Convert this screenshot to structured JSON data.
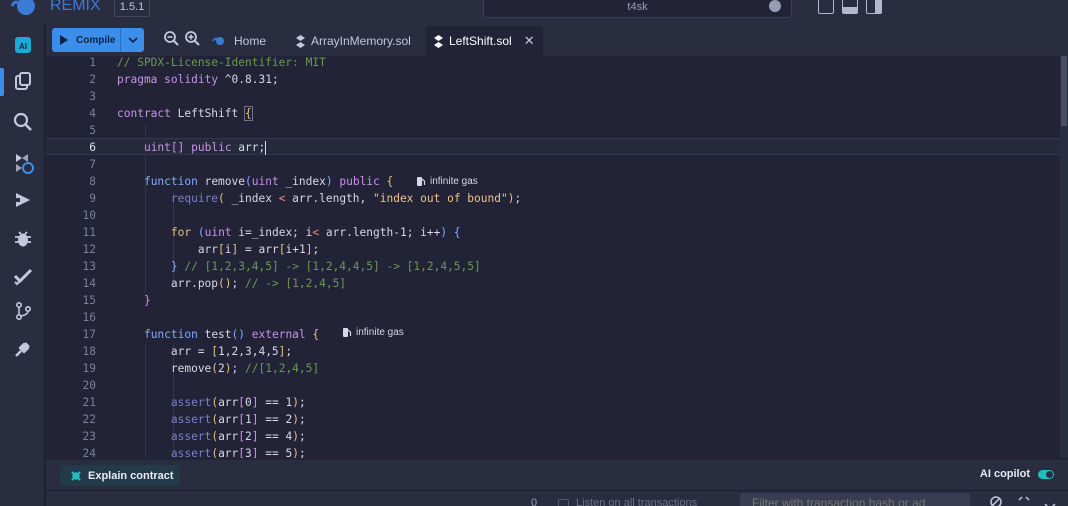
{
  "app": {
    "name": "REMIX",
    "version": "1.5.1"
  },
  "workspace": {
    "name": "t4sk"
  },
  "rail": [
    "ai-icon",
    "files-icon",
    "search-icon",
    "compiler-icon",
    "deploy-icon",
    "debugger-icon",
    "tests-icon",
    "git-icon",
    "plugin-icon"
  ],
  "toolbar": {
    "compile_label": "Compile"
  },
  "tabs": [
    {
      "label": "Home",
      "icon": "remix-home-icon"
    },
    {
      "label": "ArrayInMemory.sol",
      "icon": "solidity-icon"
    },
    {
      "label": "LeftShift.sol",
      "icon": "solidity-icon",
      "active": true
    }
  ],
  "editor": {
    "current_line": 6,
    "gas_label": "infinite gas",
    "lines": [
      "// SPDX-License-Identifier: MIT",
      "pragma solidity ^0.8.31;",
      "",
      "contract LeftShift {",
      "",
      "    uint[] public arr;",
      "",
      "    function remove(uint _index) public {",
      "        require( _index < arr.length, \"index out of bound\");",
      "",
      "        for (uint i=_index; i< arr.length-1; i++) {",
      "            arr[i] = arr[i+1];",
      "        } // [1,2,3,4,5] -> [1,2,4,4,5] -> [1,2,4,5,5]",
      "        arr.pop(); // -> [1,2,4,5]",
      "    }",
      "",
      "    function test() external {",
      "        arr = [1,2,3,4,5];",
      "        remove(2); //[1,2,4,5]",
      "",
      "        assert(arr[0] == 1);",
      "        assert(arr[1] == 2);",
      "        assert(arr[2] == 4);",
      "        assert(arr[3] == 5);"
    ]
  },
  "bottom": {
    "explain_label": "Explain contract",
    "copilot_label": "AI copilot",
    "copilot_on": true
  },
  "terminal": {
    "count": "0",
    "listen_label": "Listen on all transactions",
    "filter_placeholder": "Filter with transaction hash or ad"
  },
  "colors": {
    "accent": "#3b8eea",
    "background": "#222336",
    "panel": "#2a2c3f"
  }
}
